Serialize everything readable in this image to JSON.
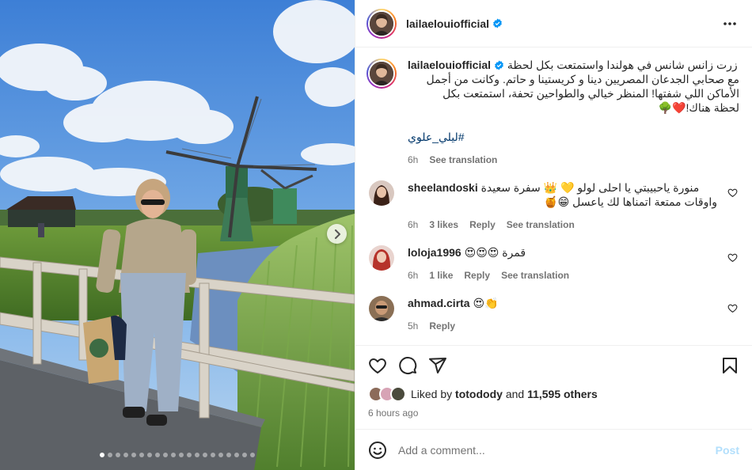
{
  "colors": {
    "link": "#00376b",
    "muted": "#737373",
    "verified": "#0095f6",
    "post_disabled": "#b2dffc"
  },
  "media": {
    "carousel": {
      "total_slides": 20,
      "active_index": 0
    },
    "next_icon": "chevron-right-icon"
  },
  "header": {
    "username": "lailaelouiofficial",
    "more_icon": "more-horizontal-icon"
  },
  "caption": {
    "username": "lailaelouiofficial",
    "lines": [
      "زرت زانس شانس في هولندا واستمتعت بكل لحظة",
      "مع صحابي الجدعان المصريين دينا و كريستينا و حاتم. وكانت من أجمل",
      "الأماكن اللي شفتها! المنظر خيالي والطواحين تحفة، استمتعت بكل",
      "لحظة هناك!❤️🌳"
    ],
    "hashtag": "#ليلي_علوي",
    "time": "6h",
    "see_translation": "See translation"
  },
  "comments": [
    {
      "username": "sheelandoski",
      "line1": "منورة ياحبيبتي يا احلى لولو 💛 👑 سفرة سعيدة",
      "line2": "واوقات ممتعة اتمناها لك ياعسل 😁🍯",
      "time": "6h",
      "likes": "3 likes",
      "reply": "Reply",
      "translate": "See translation"
    },
    {
      "username": "loloja1996",
      "line1": "قمرة 😍😍😍",
      "line2": "",
      "time": "6h",
      "likes": "1 like",
      "reply": "Reply",
      "translate": "See translation"
    },
    {
      "username": "ahmad.cirta",
      "line1": "😍👏",
      "line2": "",
      "time": "5h",
      "likes": "",
      "reply": "Reply",
      "translate": ""
    }
  ],
  "actions": {
    "like_icon": "heart-icon",
    "comment_icon": "comment-icon",
    "share_icon": "share-icon",
    "save_icon": "bookmark-icon"
  },
  "likes": {
    "prefix": "Liked by",
    "user": "totodody",
    "and": "and",
    "count": "11,595 others"
  },
  "timestamp": "6 hours ago",
  "add_comment": {
    "placeholder": "Add a comment...",
    "post_label": "Post",
    "emoji_icon": "emoji-icon"
  }
}
